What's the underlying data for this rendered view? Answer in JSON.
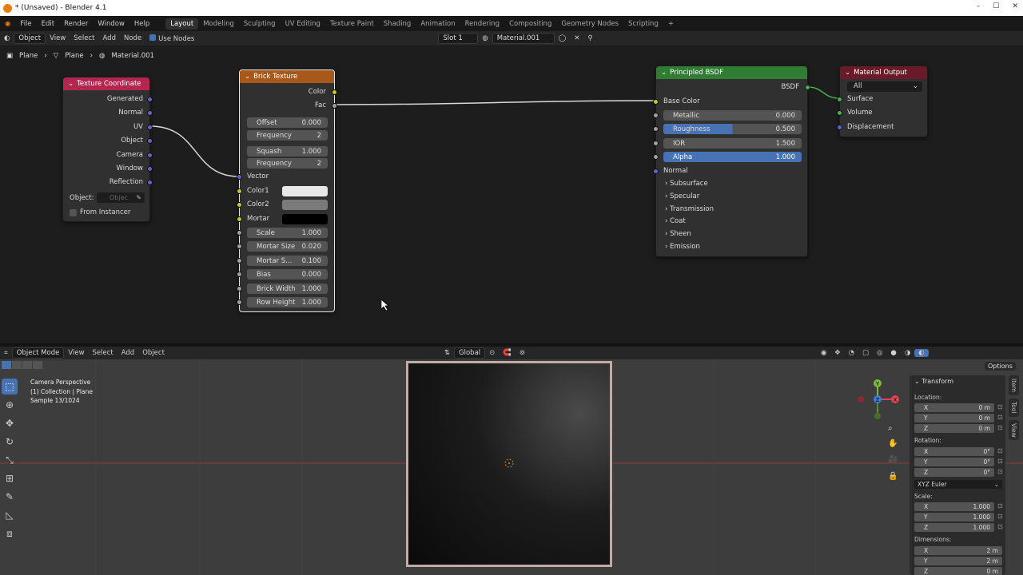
{
  "window": {
    "title": "* (Unsaved) - Blender 4.1",
    "controls": [
      "–",
      "☐",
      "✕"
    ]
  },
  "menu": {
    "items": [
      "File",
      "Edit",
      "Render",
      "Window",
      "Help"
    ]
  },
  "workspaces": [
    {
      "label": "Layout",
      "active": true
    },
    {
      "label": "Modeling",
      "active": false
    },
    {
      "label": "Sculpting",
      "active": false
    },
    {
      "label": "UV Editing",
      "active": false
    },
    {
      "label": "Texture Paint",
      "active": false
    },
    {
      "label": "Shading",
      "active": false
    },
    {
      "label": "Animation",
      "active": false
    },
    {
      "label": "Rendering",
      "active": false
    },
    {
      "label": "Compositing",
      "active": false
    },
    {
      "label": "Geometry Nodes",
      "active": false
    },
    {
      "label": "Scripting",
      "active": false
    },
    {
      "label": "+",
      "active": false
    }
  ],
  "node_header": {
    "object_mode": "Object",
    "menus": [
      "View",
      "Select",
      "Add",
      "Node"
    ],
    "use_nodes": "Use Nodes",
    "slot": "Slot 1",
    "material": "Material.001"
  },
  "breadcrumb": {
    "object": "Plane",
    "mesh": "Plane",
    "material": "Material.001"
  },
  "tex_coord": {
    "title": "Texture Coordinate",
    "outputs": [
      "Generated",
      "Normal",
      "UV",
      "Object",
      "Camera",
      "Window",
      "Reflection"
    ],
    "object_label": "Object:",
    "object_placeholder": "Objec",
    "from_instancer": "From Instancer"
  },
  "brick": {
    "title": "Brick Texture",
    "out_color": "Color",
    "out_fac": "Fac",
    "offset": {
      "label": "Offset",
      "value": "0.000"
    },
    "offset_freq": {
      "label": "Frequency",
      "value": "2"
    },
    "squash": {
      "label": "Squash",
      "value": "1.000"
    },
    "squash_freq": {
      "label": "Frequency",
      "value": "2"
    },
    "vector": "Vector",
    "color1": "Color1",
    "color2": "Color2",
    "mortar": "Mortar",
    "scale": {
      "label": "Scale",
      "value": "1.000"
    },
    "mortar_size": {
      "label": "Mortar Size",
      "value": "0.020"
    },
    "mortar_smooth": {
      "label": "Mortar S...",
      "value": "0.100"
    },
    "bias": {
      "label": "Bias",
      "value": "0.000"
    },
    "brick_width": {
      "label": "Brick Width",
      "value": "1.000"
    },
    "row_height": {
      "label": "Row Height",
      "value": "1.000"
    },
    "colors": {
      "color1": "#e8e8e8",
      "color2": "#7a7a7a",
      "mortar": "#000000"
    }
  },
  "bsdf": {
    "title": "Principled BSDF",
    "out": "BSDF",
    "base_color": "Base Color",
    "metallic": {
      "label": "Metallic",
      "value": "0.000"
    },
    "roughness": {
      "label": "Roughness",
      "value": "0.500",
      "fill": 0.5
    },
    "ior": {
      "label": "IOR",
      "value": "1.500"
    },
    "alpha": {
      "label": "Alpha",
      "value": "1.000",
      "fill": 1.0
    },
    "normal": "Normal",
    "panels": [
      "Subsurface",
      "Specular",
      "Transmission",
      "Coat",
      "Sheen",
      "Emission"
    ]
  },
  "output": {
    "title": "Material Output",
    "target": "All",
    "inputs": [
      "Surface",
      "Volume",
      "Displacement"
    ]
  },
  "viewport_header": {
    "mode": "Object Mode",
    "menus": [
      "View",
      "Select",
      "Add",
      "Object"
    ],
    "orientation": "Global",
    "options": "Options"
  },
  "viewport_info": {
    "line1": "Camera Perspective",
    "line2": "(1) Collection | Plane",
    "line3": "Sample 13/1024"
  },
  "transform": {
    "title": "Transform",
    "location_label": "Location:",
    "location": [
      {
        "axis": "X",
        "value": "0 m"
      },
      {
        "axis": "Y",
        "value": "0 m"
      },
      {
        "axis": "Z",
        "value": "0 m"
      }
    ],
    "rotation_label": "Rotation:",
    "rotation": [
      {
        "axis": "X",
        "value": "0°"
      },
      {
        "axis": "Y",
        "value": "0°"
      },
      {
        "axis": "Z",
        "value": "0°"
      }
    ],
    "rotation_mode": "XYZ Euler",
    "scale_label": "Scale:",
    "scale": [
      {
        "axis": "X",
        "value": "1.000"
      },
      {
        "axis": "Y",
        "value": "1.000"
      },
      {
        "axis": "Z",
        "value": "1.000"
      }
    ],
    "dimensions_label": "Dimensions:",
    "dimensions": [
      {
        "axis": "X",
        "value": "2 m"
      },
      {
        "axis": "Y",
        "value": "2 m"
      },
      {
        "axis": "Z",
        "value": "0 m"
      }
    ]
  },
  "side_tabs": [
    "Item",
    "Tool",
    "View"
  ],
  "gizmo": {
    "x": "X",
    "y": "Y",
    "z": "Z"
  },
  "colors": {
    "accent": "#4772b3",
    "texcoord_header": "#b3264f",
    "brick_header": "#a8591a",
    "bsdf_header": "#2e7d32",
    "output_header": "#6b1a2a"
  }
}
